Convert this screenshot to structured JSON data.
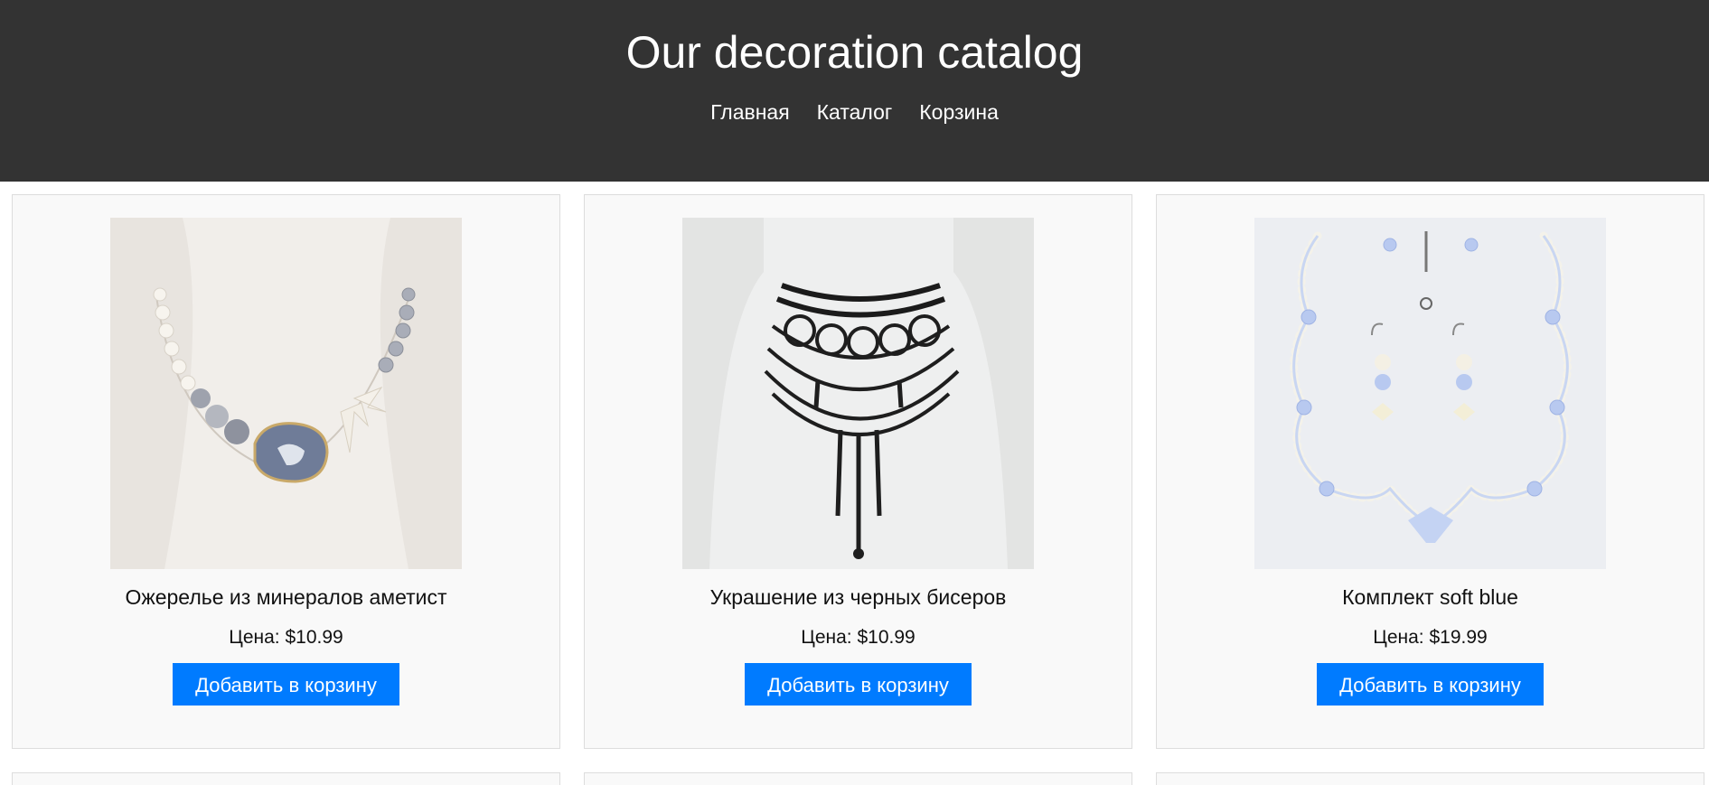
{
  "header": {
    "title": "Our decoration catalog",
    "nav": [
      "Главная",
      "Каталог",
      "Корзина"
    ]
  },
  "products": [
    {
      "name": "Ожерелье из минералов аметист",
      "price": "Цена: $10.99",
      "button": "Добавить в корзину",
      "image": "pearl-agate-necklace-image"
    },
    {
      "name": "Украшение из черных бисеров",
      "price": "Цена: $10.99",
      "button": "Добавить в корзину",
      "image": "black-bead-collar-image"
    },
    {
      "name": "Комплект soft blue",
      "price": "Цена: $19.99",
      "button": "Добавить в корзину",
      "image": "soft-blue-jewelry-set-image"
    }
  ],
  "colors": {
    "header_bg": "#333333",
    "button_bg": "#007bff",
    "card_bg": "#f9f9f9"
  }
}
